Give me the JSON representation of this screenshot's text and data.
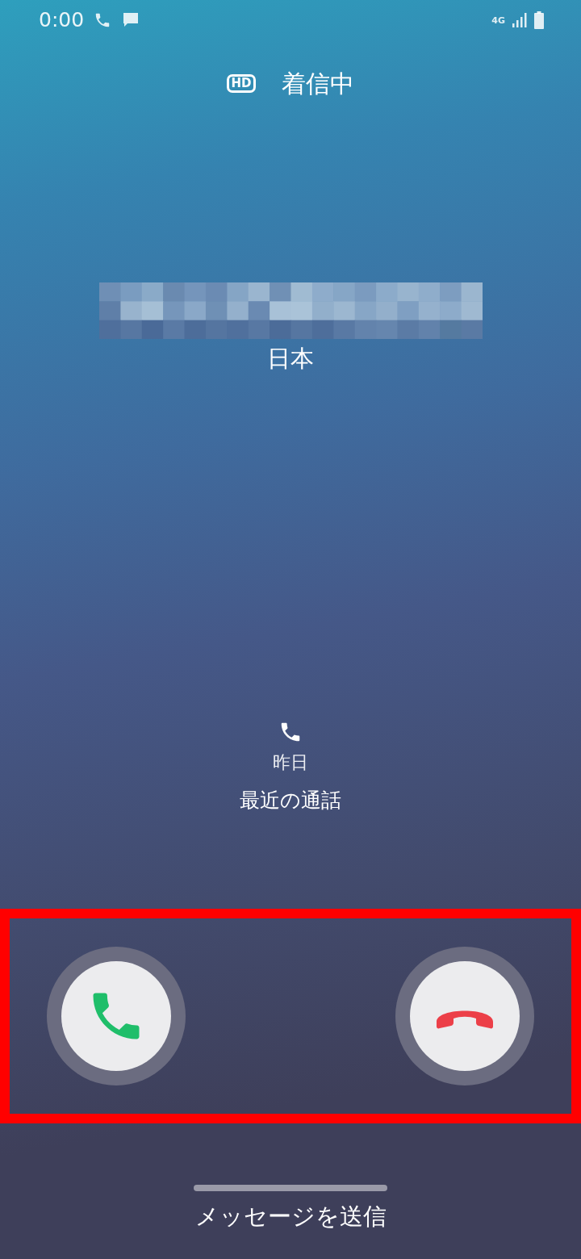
{
  "status_bar": {
    "time": "0:00",
    "network": "4G"
  },
  "header": {
    "badge": "HD",
    "title": "着信中"
  },
  "caller": {
    "location": "日本"
  },
  "recent_call": {
    "date": "昨日",
    "label": "最近の通話"
  },
  "actions": [
    {
      "kind": "answer"
    },
    {
      "kind": "decline"
    }
  ],
  "footer": {
    "label": "メッセージを送信"
  }
}
